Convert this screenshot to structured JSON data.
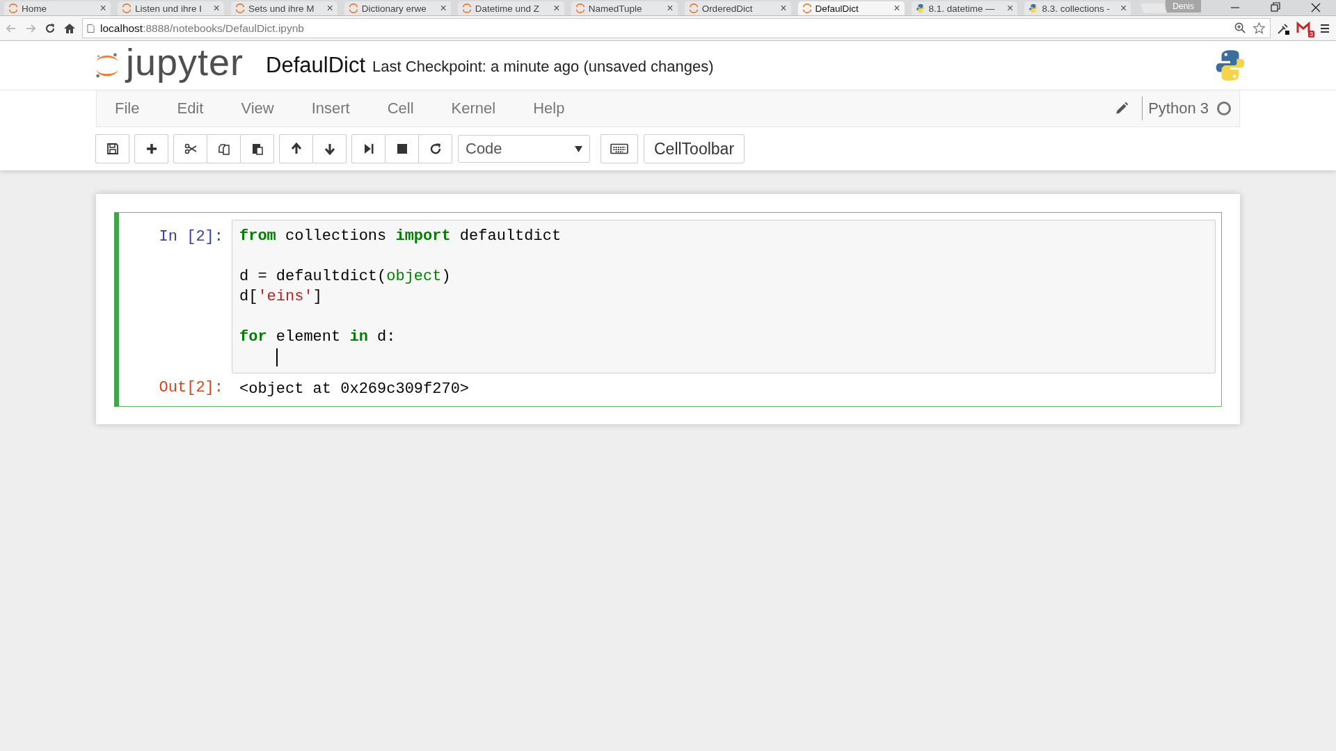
{
  "browser": {
    "tabs": [
      {
        "title": "Home",
        "kind": "jupyter",
        "close": "×",
        "selected": false
      },
      {
        "title": "Listen und ihre I",
        "kind": "jupyter",
        "close": "×",
        "selected": false
      },
      {
        "title": "Sets und ihre M",
        "kind": "jupyter",
        "close": "×",
        "selected": false
      },
      {
        "title": "Dictionary erwe",
        "kind": "jupyter",
        "close": "×",
        "selected": false
      },
      {
        "title": "Datetime und Z",
        "kind": "jupyter",
        "close": "×",
        "selected": false
      },
      {
        "title": "NamedTuple",
        "kind": "jupyter",
        "close": "×",
        "selected": false
      },
      {
        "title": "OrderedDict",
        "kind": "jupyter",
        "close": "×",
        "selected": false
      },
      {
        "title": "DefaulDict",
        "kind": "jupyter",
        "close": "×",
        "selected": true
      },
      {
        "title": "8.1. datetime —",
        "kind": "python",
        "close": "×",
        "selected": false
      },
      {
        "title": "8.3. collections -",
        "kind": "python",
        "close": "×",
        "selected": false
      }
    ],
    "profile": "Denis",
    "url_host": "localhost",
    "url_rest": ":8888/notebooks/DefaulDict.ipynb",
    "mail_badge": "3"
  },
  "header": {
    "logo_text": "jupyter",
    "notebook_name": "DefaulDict",
    "checkpoint": "Last Checkpoint: a minute ago (unsaved changes)"
  },
  "menu": [
    "File",
    "Edit",
    "View",
    "Insert",
    "Cell",
    "Kernel",
    "Help"
  ],
  "kernel": {
    "name": "Python 3",
    "busy": false
  },
  "toolbar": {
    "cell_type": "Code",
    "celltoolbar": "CellToolbar"
  },
  "cell": {
    "prompt_in": "In [2]:",
    "prompt_out": "Out[2]:",
    "cursor": true,
    "code_blocks": [
      {
        "lines": [
          [
            {
              "text": "from",
              "kind": "keyword"
            },
            {
              "text": " collections ",
              "kind": "plain"
            },
            {
              "text": "import",
              "kind": "keyword"
            },
            {
              "text": " defaultdict",
              "kind": "plain"
            }
          ]
        ]
      },
      {
        "lines": [
          [
            {
              "text": "d = defaultdict(",
              "kind": "plain"
            },
            {
              "text": "object",
              "kind": "builtin"
            },
            {
              "text": ")",
              "kind": "plain"
            }
          ],
          [
            {
              "text": "d[",
              "kind": "plain"
            },
            {
              "text": "'eins'",
              "kind": "string"
            },
            {
              "text": "]",
              "kind": "plain"
            }
          ]
        ]
      },
      {
        "lines": [
          [
            {
              "text": "for",
              "kind": "keyword"
            },
            {
              "text": " element ",
              "kind": "plain"
            },
            {
              "text": "in",
              "kind": "keyword"
            },
            {
              "text": " d:",
              "kind": "plain"
            }
          ]
        ]
      }
    ],
    "output": "<object at 0x269c309f270>"
  }
}
